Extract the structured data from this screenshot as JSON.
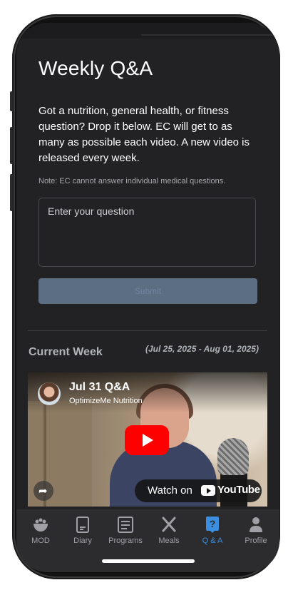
{
  "page": {
    "title": "Weekly Q&A",
    "description": "Got a nutrition, general health, or fitness question? Drop it below. EC will get to as many as possible each video. A new video is released every week.",
    "note": "Note: EC cannot answer individual medical questions."
  },
  "form": {
    "placeholder": "Enter your question",
    "submit_label": "Submit"
  },
  "current_week": {
    "heading": "Current Week",
    "date_range": "(Jul 25, 2025 - Aug 01, 2025)"
  },
  "video": {
    "title": "Jul 31 Q&A",
    "channel": "OptimizeMe Nutrition",
    "watch_label": "Watch on",
    "youtube_label": "YouTube"
  },
  "tabs": [
    {
      "label": "MOD",
      "icon": "bowl-icon",
      "active": false
    },
    {
      "label": "Diary",
      "icon": "diary-icon",
      "active": false
    },
    {
      "label": "Programs",
      "icon": "programs-icon",
      "active": false
    },
    {
      "label": "Meals",
      "icon": "utensils-icon",
      "active": false
    },
    {
      "label": "Q & A",
      "icon": "question-icon",
      "active": true
    },
    {
      "label": "Profile",
      "icon": "person-icon",
      "active": false
    }
  ],
  "colors": {
    "background": "#222224",
    "accent": "#3b8ee0",
    "submit_disabled": "#5b6e82",
    "youtube_red": "#ff0000"
  }
}
